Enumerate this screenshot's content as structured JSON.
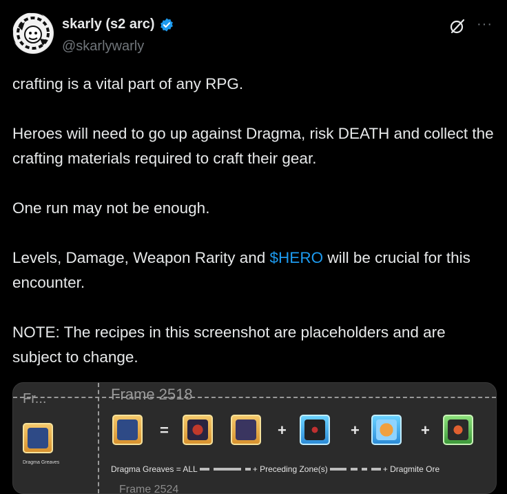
{
  "author": {
    "display_name": "skarly (s2 arc)",
    "handle": "@skarlywarly"
  },
  "tweet": {
    "p1": "crafting is a vital part of any RPG.",
    "p2": "Heroes will need to go up against Dragma, risk DEATH and collect the crafting materials required to craft their gear.",
    "p3": "One run may not be enough.",
    "p4_before": "Levels, Damage, Weapon Rarity and ",
    "p4_cashtag": "$HERO",
    "p4_after": " will be crucial for this encounter.",
    "p5": "NOTE: The recipes in this screenshot are placeholders and are subject to change."
  },
  "media": {
    "frame_label_left": "Fr...",
    "frame_label_right": "Frame 2518",
    "small_caption": "Dragma Greaves",
    "formula_start": "Dragma Greaves = ALL",
    "formula_mid": "+ Preceding Zone(s)",
    "formula_end": "+ Dragmite Ore",
    "next_frame": "Frame 2524",
    "ops": {
      "equals": "=",
      "plus": "+"
    }
  },
  "icons": {
    "verified": "verified-badge-icon",
    "grok": "grok-slash-icon",
    "more": "more-dots-icon"
  },
  "colors": {
    "accent": "#1d9bf0",
    "gold_slot": "#e1a948",
    "blue_slot": "#49b3f0",
    "green_slot": "#5cbf56"
  }
}
